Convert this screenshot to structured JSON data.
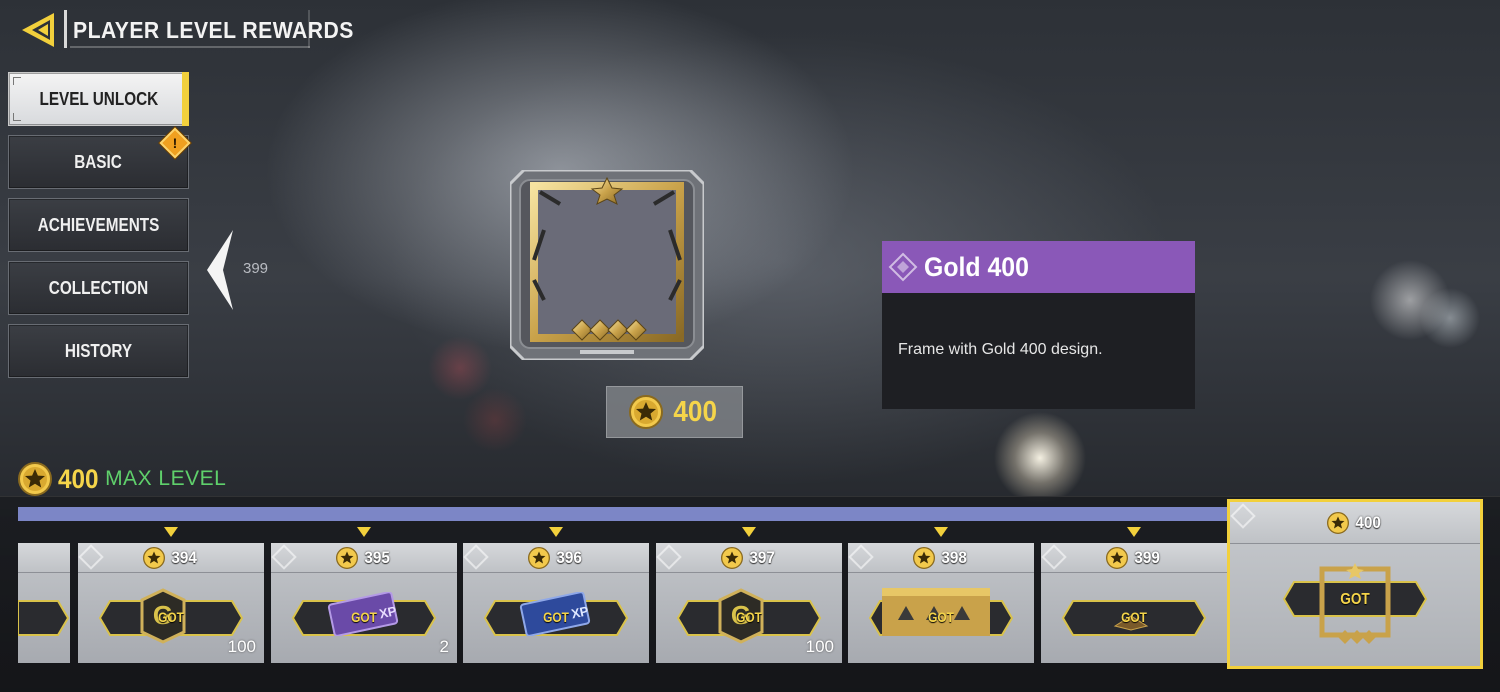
{
  "header": {
    "title": "PLAYER LEVEL REWARDS",
    "back_icon": "back-arrow-icon"
  },
  "sidebar": {
    "items": [
      {
        "label": "LEVEL UNLOCK",
        "active": true
      },
      {
        "label": "BASIC",
        "alert": "!"
      },
      {
        "label": "ACHIEVEMENTS"
      },
      {
        "label": "COLLECTION"
      },
      {
        "label": "HISTORY"
      }
    ]
  },
  "preview": {
    "prev_level": "399",
    "price": "400",
    "item_name": "Gold 400",
    "item_description": "Frame with Gold 400 design."
  },
  "status": {
    "level": "400",
    "max_label": "MAX LEVEL"
  },
  "track": {
    "got_label": "GOT",
    "rewards": [
      {
        "level": "394",
        "qty": "100",
        "icon": "weapon-xp-card-icon"
      },
      {
        "level": "395",
        "qty": "2",
        "icon": "purple-xp-card-icon"
      },
      {
        "level": "396",
        "qty": "",
        "icon": "blue-xp-card-icon"
      },
      {
        "level": "397",
        "qty": "100",
        "icon": "weapon-xp-card-icon"
      },
      {
        "level": "398",
        "qty": "",
        "icon": "gold-banner-icon"
      },
      {
        "level": "399",
        "qty": "",
        "icon": "small-item-icon"
      },
      {
        "level": "400",
        "qty": "",
        "icon": "gold-frame-icon"
      }
    ]
  },
  "colors": {
    "accent": "#f2d03c",
    "progress": "#7c86c6",
    "rarity_purple": "#8a58b8",
    "max_level_green": "#5fd06b"
  }
}
